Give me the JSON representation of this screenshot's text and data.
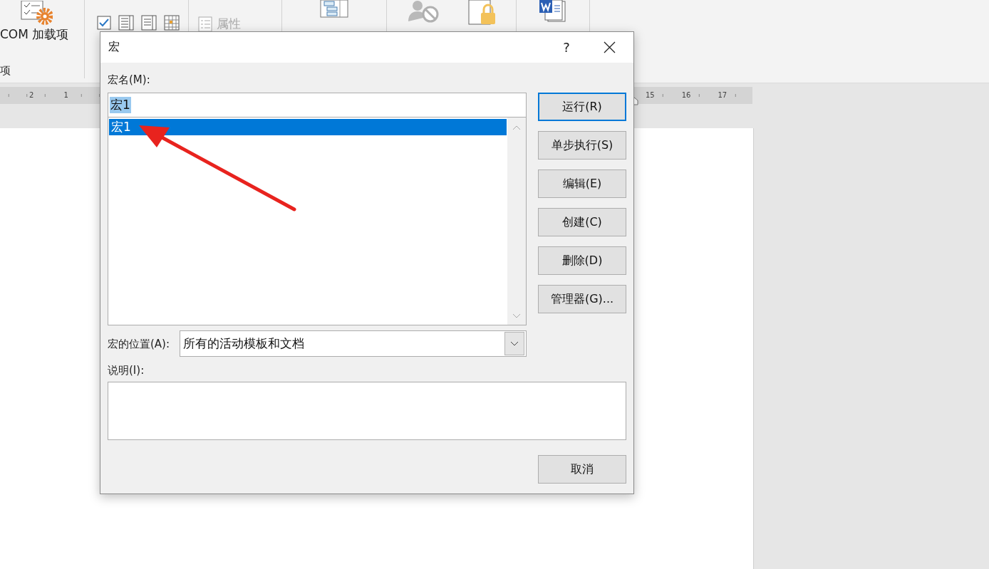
{
  "ribbon": {
    "com_addins_button": "COM 加载项",
    "group_label": "项",
    "properties_button": {
      "label": "属性",
      "disabled": true
    }
  },
  "ruler": {
    "left_numbers": [
      "2",
      "1"
    ],
    "right_numbers": [
      "15",
      "16",
      "17"
    ]
  },
  "dialog": {
    "title": "宏",
    "help": "?",
    "macro_name_label": "宏名(M):",
    "macro_name_value": "宏1",
    "macro_name_text_selected": true,
    "macros": [
      {
        "name": "宏1",
        "selected": true
      }
    ],
    "buttons": [
      {
        "label": "运行(R)",
        "focused": true
      },
      {
        "label": "单步执行(S)",
        "focused": false
      },
      {
        "label": "编辑(E)",
        "focused": false
      },
      {
        "label": "创建(C)",
        "focused": false
      },
      {
        "label": "删除(D)",
        "focused": false
      },
      {
        "label": "管理器(G)...",
        "focused": false
      }
    ],
    "location_label": "宏的位置(A):",
    "location_value": "所有的活动模板和文档",
    "description_label": "说明(I):",
    "cancel": "取消"
  }
}
